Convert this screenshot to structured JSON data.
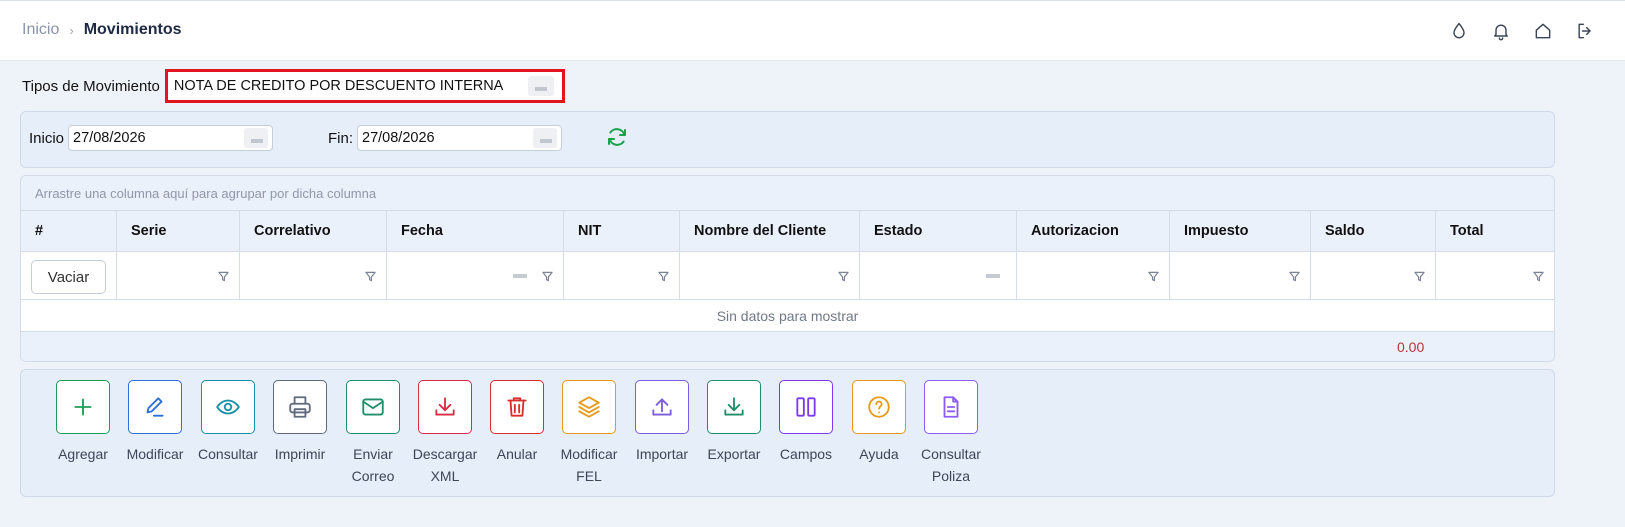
{
  "breadcrumb": {
    "home": "Inicio",
    "current": "Movimientos"
  },
  "header_icons": [
    "droplet-icon",
    "bell-icon",
    "home-icon",
    "logout-icon"
  ],
  "movement_type": {
    "label": "Tipos de Movimiento",
    "value": "NOTA DE CREDITO POR DESCUENTO INTERNA"
  },
  "dates": {
    "start_label": "Inicio",
    "start_value": "27/08/2026",
    "end_label": "Fin:",
    "end_value": "27/08/2026"
  },
  "grid": {
    "group_panel": "Arrastre una columna aquí para agrupar por dicha columna",
    "columns": [
      "#",
      "Serie",
      "Correlativo",
      "Fecha",
      "NIT",
      "Nombre del Cliente",
      "Estado",
      "Autorizacion",
      "Impuesto",
      "Saldo",
      "Total"
    ],
    "clear_button": "Vaciar",
    "empty_text": "Sin datos para mostrar",
    "total_value": "0.00"
  },
  "toolbar": [
    {
      "line1": "Agregar",
      "line2": "",
      "icon": "plus-icon",
      "color": "#1f9d55"
    },
    {
      "line1": "Modificar",
      "line2": "",
      "icon": "edit-icon",
      "color": "#2f6fd8"
    },
    {
      "line1": "Consultar",
      "line2": "",
      "icon": "eye-icon",
      "color": "#1a8fa8"
    },
    {
      "line1": "Imprimir",
      "line2": "",
      "icon": "printer-icon",
      "color": "#5f6b7d"
    },
    {
      "line1": "Enviar",
      "line2": "Correo",
      "icon": "mail-icon",
      "color": "#1f8f6a"
    },
    {
      "line1": "Descargar",
      "line2": "XML",
      "icon": "download-icon",
      "color": "#d92d45"
    },
    {
      "line1": "Anular",
      "line2": "",
      "icon": "trash-icon",
      "color": "#d92d2d"
    },
    {
      "line1": "Modificar",
      "line2": "FEL",
      "icon": "layers-icon",
      "color": "#e69a16"
    },
    {
      "line1": "Importar",
      "line2": "",
      "icon": "upload-icon",
      "color": "#7c5ce0"
    },
    {
      "line1": "Exportar",
      "line2": "",
      "icon": "download-icon",
      "color": "#1f8f6a"
    },
    {
      "line1": "Campos",
      "line2": "",
      "icon": "columns-icon",
      "color": "#7c3aed"
    },
    {
      "line1": "Ayuda",
      "line2": "",
      "icon": "help-icon",
      "color": "#e69a16"
    },
    {
      "line1": "Consultar",
      "line2": "Poliza",
      "icon": "document-icon",
      "color": "#8b5cf6"
    }
  ]
}
